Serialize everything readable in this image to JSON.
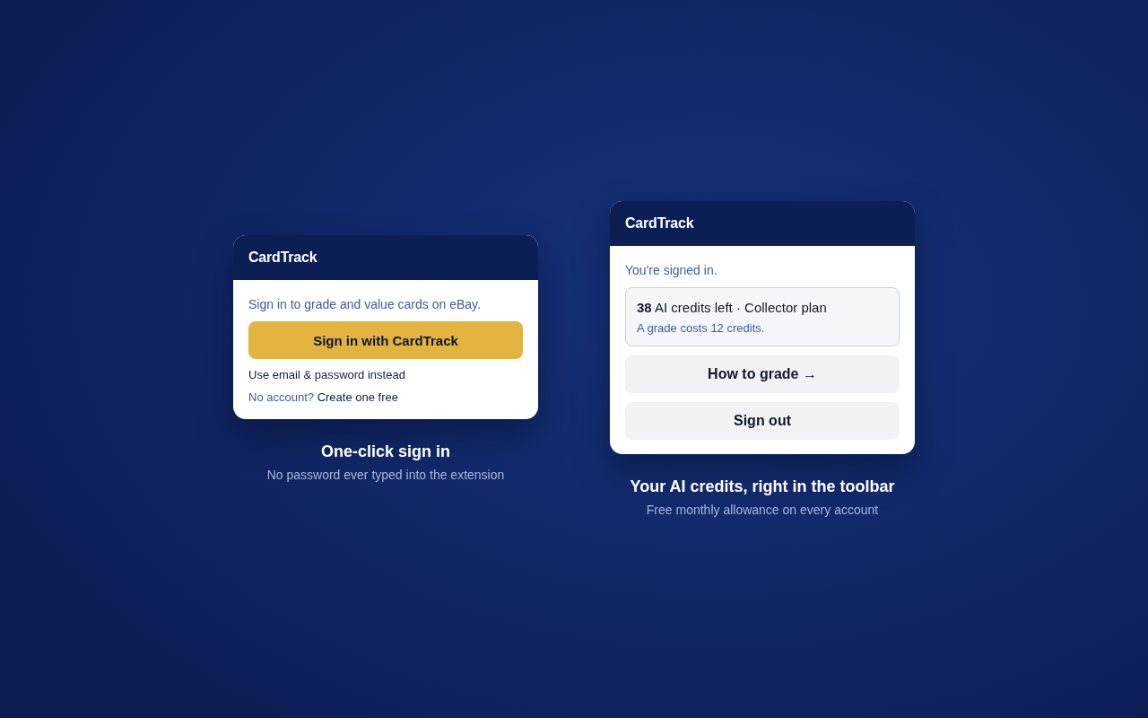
{
  "panels": [
    {
      "kind": "signed_out",
      "header": {
        "title": "CardTrack"
      },
      "prompt": "Sign in to grade and value cards on eBay.",
      "primary_button": "Sign in with CardTrack",
      "alt_link": "Use email & password instead",
      "signup": {
        "text": "No account?",
        "link": "Create one free"
      },
      "caption": {
        "title": "One-click sign in",
        "subtitle": "No password ever typed into the extension"
      }
    },
    {
      "kind": "signed_in",
      "header": {
        "title": "CardTrack"
      },
      "status": "You're signed in.",
      "credits": {
        "summary": "**38** AI credits left · Collector plan",
        "note": "A grade costs 12 credits."
      },
      "buttons": [
        "How to grade →",
        "Sign out"
      ],
      "caption": {
        "title": "Your AI credits, right in the toolbar",
        "subtitle": "Free monthly allowance on every account"
      }
    }
  ]
}
